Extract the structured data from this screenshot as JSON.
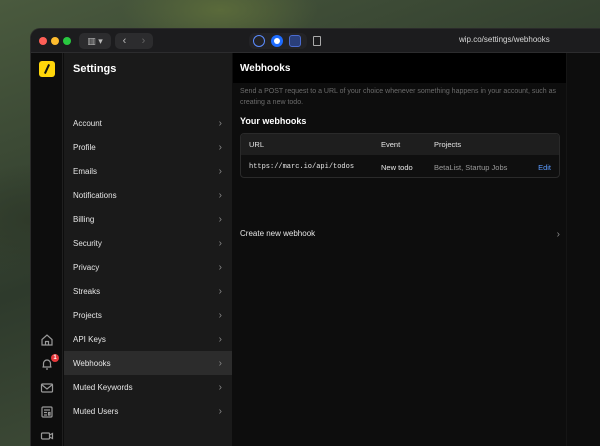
{
  "browser": {
    "url": "wip.co/settings/webhooks",
    "back_glyph": "‹",
    "forward_glyph": "›",
    "sidebar_toggle_glyph": "▥ ▾"
  },
  "rail": {
    "icons": [
      "logo",
      "home-icon",
      "bell-icon",
      "mail-icon",
      "newspaper-icon",
      "video-icon",
      "search-icon"
    ],
    "notification_count": "1",
    "accent": "#ffd60a"
  },
  "settings": {
    "title": "Settings",
    "items": [
      {
        "label": "Account"
      },
      {
        "label": "Profile"
      },
      {
        "label": "Emails"
      },
      {
        "label": "Notifications"
      },
      {
        "label": "Billing"
      },
      {
        "label": "Security"
      },
      {
        "label": "Privacy"
      },
      {
        "label": "Streaks"
      },
      {
        "label": "Projects"
      },
      {
        "label": "API Keys"
      },
      {
        "label": "Webhooks",
        "active": true
      },
      {
        "label": "Muted Keywords"
      },
      {
        "label": "Muted Users"
      }
    ],
    "chevron": "›"
  },
  "main": {
    "title": "Webhooks",
    "description": "Send a POST request to a URL of your choice whenever something happens in your account, such as creating a new todo.",
    "section_title": "Your webhooks",
    "table": {
      "headers": {
        "url": "URL",
        "event": "Event",
        "projects": "Projects"
      },
      "rows": [
        {
          "url": "https://marc.io/api/todos",
          "event": "New todo",
          "projects": "BetaList, Startup Jobs",
          "action": "Edit"
        }
      ]
    },
    "create_label": "Create new webhook",
    "chevron": "›",
    "link_color": "#5b9bff"
  }
}
